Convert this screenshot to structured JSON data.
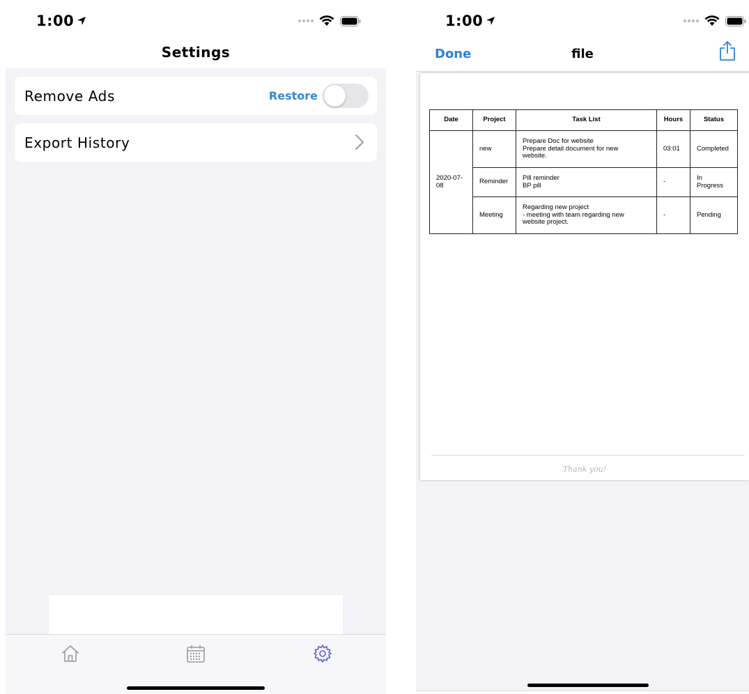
{
  "left_screen": {
    "status_bar": {
      "time": "1:00"
    },
    "nav": {
      "title": "Settings"
    },
    "rows": {
      "remove_ads": {
        "label": "Remove Ads",
        "restore_label": "Restore",
        "toggle_on": false
      },
      "export_history": {
        "label": "Export History"
      }
    },
    "tab_bar": {
      "tabs": [
        {
          "icon": "home-icon",
          "selected": false
        },
        {
          "icon": "calendar-icon",
          "selected": false
        },
        {
          "icon": "gear-icon",
          "selected": true
        }
      ]
    }
  },
  "right_screen": {
    "status_bar": {
      "time": "1:00"
    },
    "nav": {
      "done_label": "Done",
      "title": "file",
      "share_icon": "share-icon"
    },
    "document": {
      "table": {
        "headers": [
          "Date",
          "Project",
          "Task List",
          "Hours",
          "Status"
        ],
        "date": "2020-07-\n08",
        "rows": [
          {
            "project": "new",
            "task": "Prepare Doc for website\nPrepare detail document for new\nwebsite.",
            "hours": "03:01",
            "status": "Completed"
          },
          {
            "project": "Reminder",
            "task": "Pill reminder\nBP pill",
            "hours": "-",
            "status": "In\nProgress"
          },
          {
            "project": "Meeting",
            "task": "Regarding new project\n- meeting with team regarding new\nwebsite project.",
            "hours": "-",
            "status": "Pending"
          }
        ]
      },
      "footer": "Thank you!"
    }
  },
  "colors": {
    "accent_blue": "#2f82d8",
    "selected_tab": "#5b5bd6",
    "grouped_background": "#f2f2f7"
  }
}
